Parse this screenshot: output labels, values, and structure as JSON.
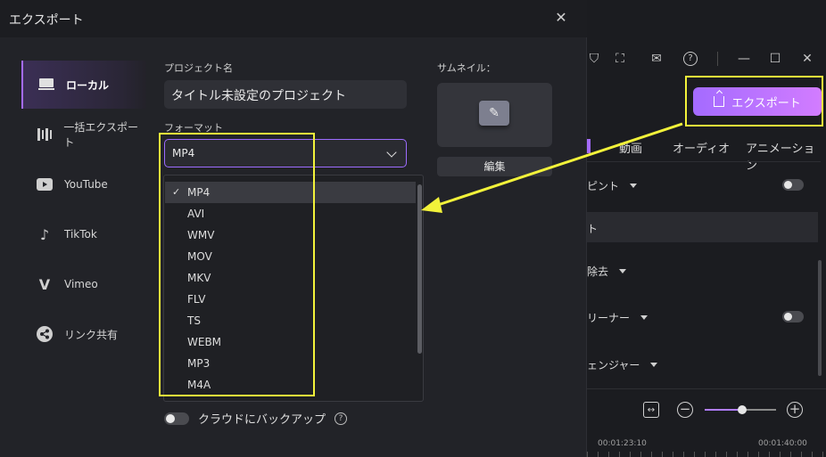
{
  "dialog": {
    "title": "エクスポート",
    "sidebar": [
      {
        "label": "ローカル",
        "icon": "monitor-icon",
        "active": true
      },
      {
        "label": "一括エクスポート",
        "icon": "batch-icon"
      },
      {
        "label": "YouTube",
        "icon": "youtube-icon"
      },
      {
        "label": "TikTok",
        "icon": "tiktok-icon"
      },
      {
        "label": "Vimeo",
        "icon": "vimeo-icon"
      },
      {
        "label": "リンク共有",
        "icon": "share-icon"
      }
    ],
    "project_name_label": "プロジェクト名",
    "project_name_value": "タイトル未設定のプロジェクト",
    "format_label": "フォーマット",
    "format_value": "MP4",
    "format_options": [
      "MP4",
      "AVI",
      "WMV",
      "MOV",
      "MKV",
      "FLV",
      "TS",
      "WEBM",
      "MP3",
      "M4A"
    ],
    "thumbnail_label": "サムネイル：",
    "edit_label": "編集",
    "cloud_backup_label": "クラウドにバックアップ",
    "help_glyph": "?"
  },
  "app": {
    "export_button": "エクスポート",
    "tabs": [
      "動画",
      "オーディオ",
      "アニメーション"
    ],
    "rows": [
      "ピント",
      "ト",
      "除去",
      "リーナー",
      "ェンジャー"
    ],
    "timeline": {
      "time_a": "00:01:23:10",
      "time_b": "00:01:40:00"
    }
  },
  "colors": {
    "accent": "#a46bff",
    "highlight": "#f2f23a"
  }
}
